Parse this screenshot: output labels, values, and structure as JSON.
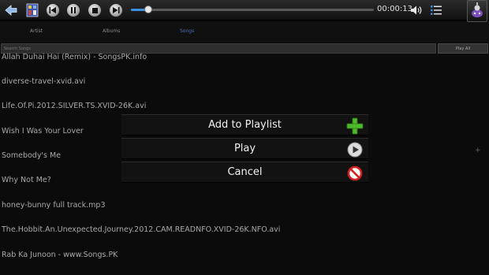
{
  "toolbar": {
    "time": "00:00:13",
    "progress": 0.07
  },
  "tabs": [
    {
      "label": "Artist",
      "active": false
    },
    {
      "label": "Albums",
      "active": false
    },
    {
      "label": "Songs",
      "active": true
    }
  ],
  "search": {
    "placeholder": "Search Songs",
    "play_all": "Play All"
  },
  "songs": [
    "Allah Duhai Hai (Remix) - SongsPK.info",
    "diverse-travel-xvid.avi",
    "Life.Of.Pi.2012.SILVER.TS.XVID-26K.avi",
    "Wish I Was Your Lover",
    "Somebody's Me",
    "Why Not Me?",
    "honey-bunny full track.mp3",
    "The.Hobbit.An.Unexpected.Journey.2012.CAM.READNFO.XVID-26K.NFO.avi",
    "Rab Ka Junoon - www.Songs.PK"
  ],
  "dialog": {
    "items": [
      {
        "label": "Add to Playlist",
        "icon": "plus-icon"
      },
      {
        "label": "Play",
        "icon": "play-icon"
      },
      {
        "label": "Cancel",
        "icon": "cancel-icon"
      }
    ]
  },
  "colors": {
    "accent": "#3d8fe0",
    "active_tab": "#4a72b8",
    "plus_green": "#4fb82b",
    "cancel_red": "#d42020"
  }
}
